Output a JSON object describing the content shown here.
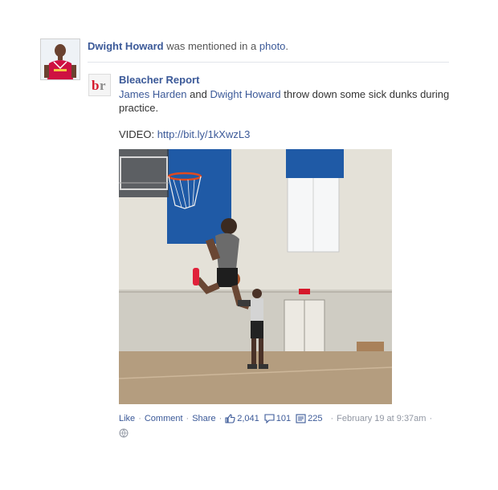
{
  "story": {
    "actor_name": "Dwight Howard",
    "action_text": "was mentioned in a",
    "object_link": "photo",
    "period": "."
  },
  "post": {
    "source_name": "Bleacher Report",
    "logo_text": "br",
    "mention1": "James Harden",
    "and_text": "and",
    "mention2": "Dwight Howard",
    "rest_text": "throw down some sick dunks during practice.",
    "video_label": "VIDEO:",
    "video_url": "http://bit.ly/1kXwzL3"
  },
  "actions": {
    "like": "Like",
    "comment": "Comment",
    "share": "Share",
    "sep": "·",
    "likes_count": "2,041",
    "comments_count": "101",
    "shares_count": "225",
    "timestamp": "February 19 at 9:37am"
  },
  "colors": {
    "link": "#3b5998",
    "meta": "#9197a3",
    "rockets_red": "#ce1141"
  },
  "icons": {
    "like": "thumbs-up-icon",
    "comment": "speech-bubble-icon",
    "share": "share-doc-icon",
    "privacy": "globe-icon"
  }
}
